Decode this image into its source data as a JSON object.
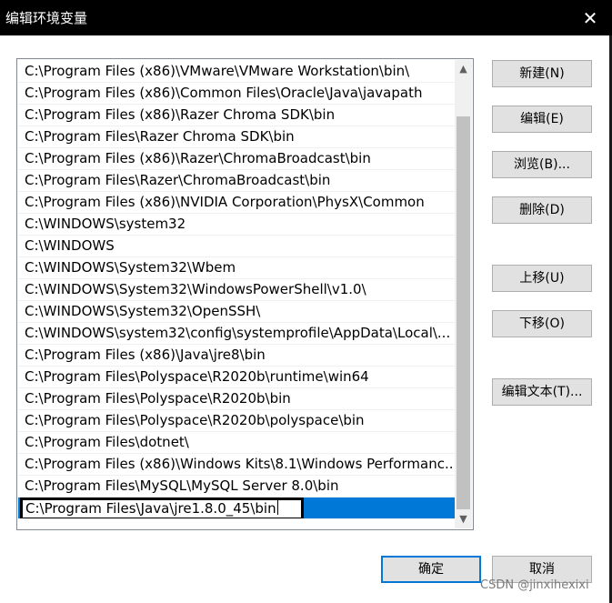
{
  "window": {
    "title": "编辑环境变量",
    "close_glyph": "✕"
  },
  "path_list": {
    "entries": [
      "C:\\Program Files (x86)\\VMware\\VMware Workstation\\bin\\",
      "C:\\Program Files (x86)\\Common Files\\Oracle\\Java\\javapath",
      "C:\\Program Files (x86)\\Razer Chroma SDK\\bin",
      "C:\\Program Files\\Razer Chroma SDK\\bin",
      "C:\\Program Files (x86)\\Razer\\ChromaBroadcast\\bin",
      "C:\\Program Files\\Razer\\ChromaBroadcast\\bin",
      "C:\\Program Files (x86)\\NVIDIA Corporation\\PhysX\\Common",
      "C:\\WINDOWS\\system32",
      "C:\\WINDOWS",
      "C:\\WINDOWS\\System32\\Wbem",
      "C:\\WINDOWS\\System32\\WindowsPowerShell\\v1.0\\",
      "C:\\WINDOWS\\System32\\OpenSSH\\",
      "C:\\WINDOWS\\system32\\config\\systemprofile\\AppData\\Local\\...",
      "C:\\Program Files (x86)\\Java\\jre8\\bin",
      "C:\\Program Files\\Polyspace\\R2020b\\runtime\\win64",
      "C:\\Program Files\\Polyspace\\R2020b\\bin",
      "C:\\Program Files\\Polyspace\\R2020b\\polyspace\\bin",
      "C:\\Program Files\\dotnet\\",
      "C:\\Program Files (x86)\\Windows Kits\\8.1\\Windows Performanc...",
      "C:\\Program Files\\MySQL\\MySQL Server 8.0\\bin"
    ],
    "editing_value": "C:\\Program Files\\Java\\jre1.8.0_45\\bin",
    "selection_color": "#0078d7"
  },
  "scrollbar": {
    "up_icon": "up-arrow",
    "down_icon": "down-arrow"
  },
  "buttons": {
    "new": "新建(N)",
    "edit": "编辑(E)",
    "browse": "浏览(B)...",
    "delete": "删除(D)",
    "move_up": "上移(U)",
    "move_down": "下移(O)",
    "edit_text": "编辑文本(T)...",
    "ok": "确定",
    "cancel": "取消"
  },
  "watermark": "CSDN @jinxihexixi"
}
